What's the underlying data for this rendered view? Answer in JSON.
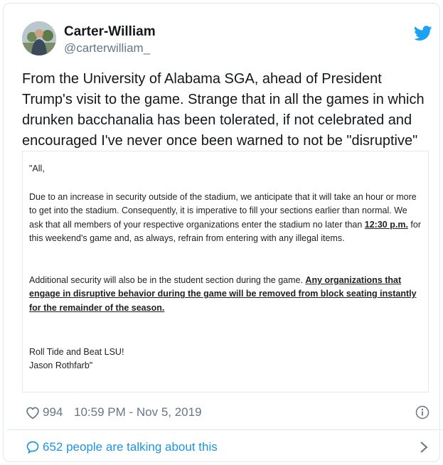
{
  "author": {
    "name": "Carter-William",
    "handle": "@carterwilliam_"
  },
  "tweet": {
    "text": "From the University of Alabama SGA, ahead of President Trump's visit to the game. Strange that in all the games in which drunken bacchanalia has been tolerated, if not celebrated and encouraged I've never once been warned to not be \"disruptive\""
  },
  "memo": {
    "salutation": "\"All,",
    "p1_before": "Due to an increase in security outside of the stadium, we anticipate that it will take an hour or more to get into the stadium. Consequently, it is imperative to fill your sections earlier than normal. We ask that all members of your respective organizations enter the stadium no later than ",
    "p1_time": "12:30 p.m.",
    "p1_after": " for this weekend's game and, as always, refrain from entering with any illegal items.",
    "p2_before": "Additional security will also be in the student section during the game. ",
    "p2_emphasis": "Any organizations that engage in disruptive behavior during the game will be removed from block seating instantly for the remainder of the season.",
    "closing": "Roll Tide and Beat LSU!",
    "signature": "Jason Rothfarb\""
  },
  "meta": {
    "likes": "994",
    "timestamp": "10:59 PM - Nov 5, 2019"
  },
  "footer": {
    "talking": "652 people are talking about this"
  },
  "colors": {
    "twitter_blue": "#1da1f2",
    "link_blue": "#1b95e0",
    "secondary_gray": "#657786",
    "border": "#e1e8ed"
  },
  "icons": [
    "twitter-bird-icon",
    "heart-icon",
    "info-icon",
    "comment-icon",
    "chevron-right-icon"
  ]
}
